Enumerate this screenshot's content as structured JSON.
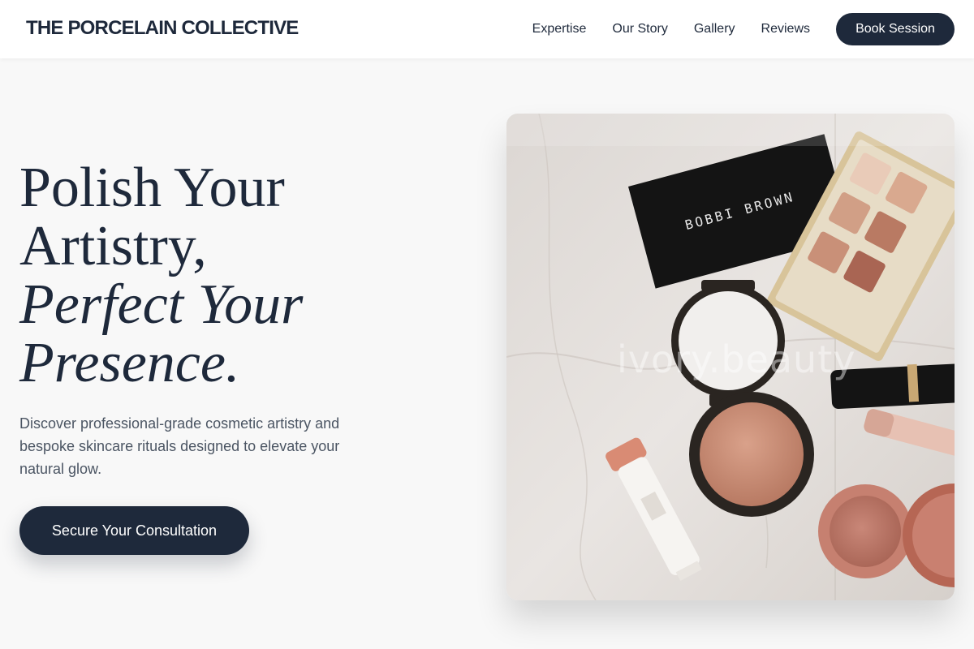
{
  "header": {
    "brand": "THE PORCELAIN COLLECTIVE",
    "nav_items": [
      "Expertise",
      "Our Story",
      "Gallery",
      "Reviews"
    ],
    "cta_label": "Book Session"
  },
  "hero": {
    "title_line1": "Polish Your",
    "title_line2": "Artistry,",
    "title_line3": "Perfect Your",
    "title_line4": "Presence.",
    "description": "Discover professional-grade cosmetic artistry and bespoke skincare rituals designed to elevate your natural glow.",
    "cta_label": "Secure Your Consultation"
  },
  "image": {
    "product_brand": "BOBBI BROWN",
    "watermark": "ivory.beauty"
  },
  "colors": {
    "primary": "#1e293b",
    "background": "#f8f8f8",
    "text_muted": "#4b5563"
  }
}
